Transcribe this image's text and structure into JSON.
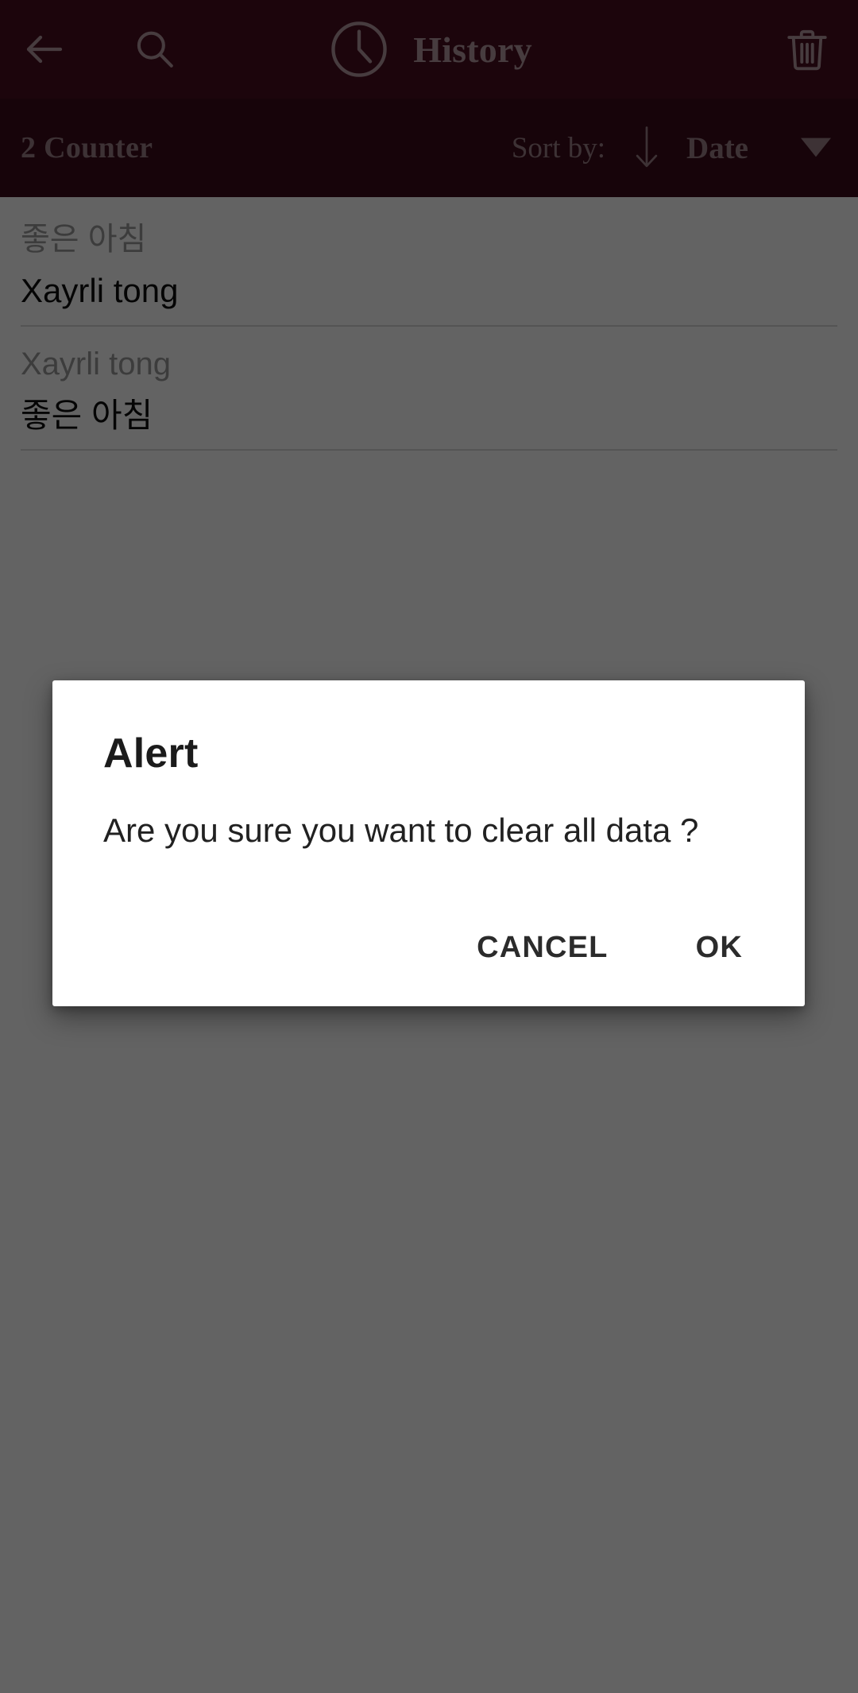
{
  "appbar": {
    "back_icon": "arrow-left-icon",
    "search_icon": "search-icon",
    "clock_icon": "clock-icon",
    "title": "History",
    "delete_icon": "trash-icon",
    "background_color": "#4A0D1F",
    "foreground_color": "#B89AA2"
  },
  "sortbar": {
    "counter_label": "2 Counter",
    "sort_by_label": "Sort by:",
    "sort_direction_icon": "arrow-down-icon",
    "sort_value": "Date",
    "dropdown_icon": "caret-down-icon",
    "background_color": "#3D0B1A",
    "foreground_color": "#9E8189"
  },
  "history": {
    "items": [
      {
        "source": "좋은 아침",
        "target": "Xayrli tong"
      },
      {
        "source": "Xayrli tong",
        "target": "좋은 아침"
      }
    ]
  },
  "dialog": {
    "title": "Alert",
    "message": "Are you sure you want to clear all data ?",
    "cancel_label": "CANCEL",
    "ok_label": "OK",
    "surface_color": "#FFFFFF",
    "text_color": "#212121"
  },
  "scrim": {
    "color": "#636363"
  }
}
